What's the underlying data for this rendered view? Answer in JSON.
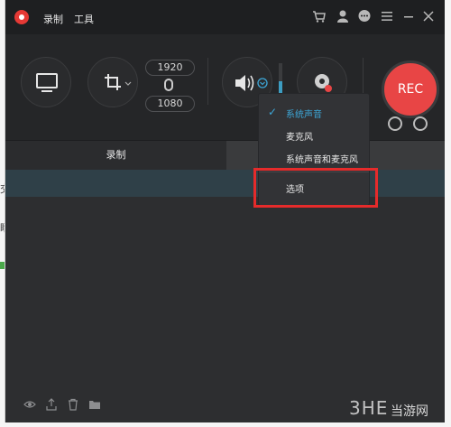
{
  "app": {
    "menu": [
      "录制",
      "工具"
    ],
    "colors": {
      "accent": "#3da7d8",
      "rec": "#e84545",
      "highlight": "#e52b2b"
    },
    "titlebar_icons": [
      "cart-icon",
      "user-icon",
      "chat-icon",
      "menu-icon",
      "minimize-icon",
      "close-icon"
    ]
  },
  "toolbar": {
    "width": "1920",
    "height": "1080",
    "rec_label": "REC"
  },
  "tabs": [
    "录制",
    ""
  ],
  "audio_menu": {
    "items": [
      "系统声音",
      "麦克风",
      "系统声音和麦克风"
    ],
    "selected": "系统声音",
    "options": "选项"
  },
  "bottom_icons": [
    "eye-icon",
    "share-icon",
    "trash-icon",
    "folder-icon"
  ],
  "edge_text": [
    "交",
    "睛"
  ],
  "watermark": {
    "logo": "3HE",
    "text": "当游网"
  }
}
